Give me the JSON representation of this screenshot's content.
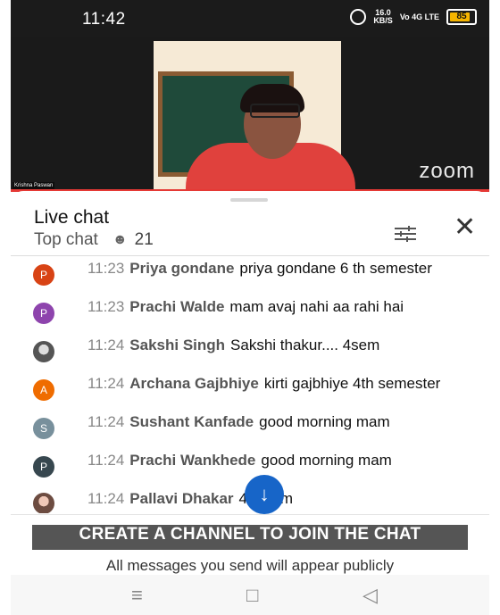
{
  "status": {
    "time": "11:42",
    "net_speed_value": "16.0",
    "net_speed_unit": "KB/S",
    "network": "Vo 4G LTE",
    "battery": "85"
  },
  "video": {
    "brand": "zoom",
    "participant": "Krishna Paswan"
  },
  "chat": {
    "title": "Live chat",
    "mode": "Top chat",
    "viewers": "21",
    "messages": [
      {
        "time": "11:23",
        "author": "Priya gondane",
        "text": "priya gondane 6 th semester",
        "avatar": "P",
        "avatar_color": "#d84315"
      },
      {
        "time": "11:23",
        "author": "Prachi Walde",
        "text": "mam avaj nahi aa rahi hai",
        "avatar": "P",
        "avatar_color": "#8e44ad"
      },
      {
        "time": "11:24",
        "author": "Sakshi Singh",
        "text": "Sakshi thakur.... 4sem",
        "avatar": "",
        "avatar_color": "#6d6d6d"
      },
      {
        "time": "11:24",
        "author": "Archana Gajbhiye",
        "text": "kirti gajbhiye 4th semester",
        "avatar": "A",
        "avatar_color": "#ef6c00"
      },
      {
        "time": "11:24",
        "author": "Sushant Kanfade",
        "text": "good morning mam",
        "avatar": "S",
        "avatar_color": "#78909c"
      },
      {
        "time": "11:24",
        "author": "Prachi Wankhede",
        "text": "good morning mam",
        "avatar": "P",
        "avatar_color": "#37474f"
      },
      {
        "time": "11:24",
        "author": "Pallavi Dhakar",
        "text": "4th sem",
        "avatar": "",
        "avatar_color": "#8d6e63"
      }
    ],
    "create_channel": "CREATE A CHANNEL TO JOIN THE CHAT",
    "notice": "All messages you send will appear publicly"
  },
  "icons": {
    "scroll_down": "arrow-down-icon",
    "filter": "tune-icon",
    "close": "close-icon"
  }
}
